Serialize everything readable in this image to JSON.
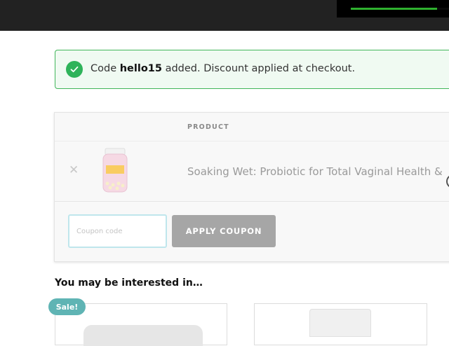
{
  "header": {
    "progress_percent": 88,
    "progress_color": "#2fb12f",
    "background_color": "#222222"
  },
  "notice": {
    "prefix": "Code",
    "code": "hello15",
    "suffix": "added. Discount applied at checkout.",
    "icon": "check-circle-icon",
    "accent_color": "#2fb35a"
  },
  "cart": {
    "columns": [
      "PRODUCT"
    ],
    "items": [
      {
        "name": "Soaking Wet: Probiotic for Total Vaginal Health &",
        "remove_icon": "close-icon",
        "thumbnail_label": "SOAKING WET"
      }
    ],
    "coupon": {
      "placeholder": "Coupon code",
      "value": "",
      "button_label": "APPLY COUPON"
    }
  },
  "related": {
    "title": "You may be interested in…",
    "badge": "Sale!",
    "badge_color": "#5fb4b4"
  }
}
